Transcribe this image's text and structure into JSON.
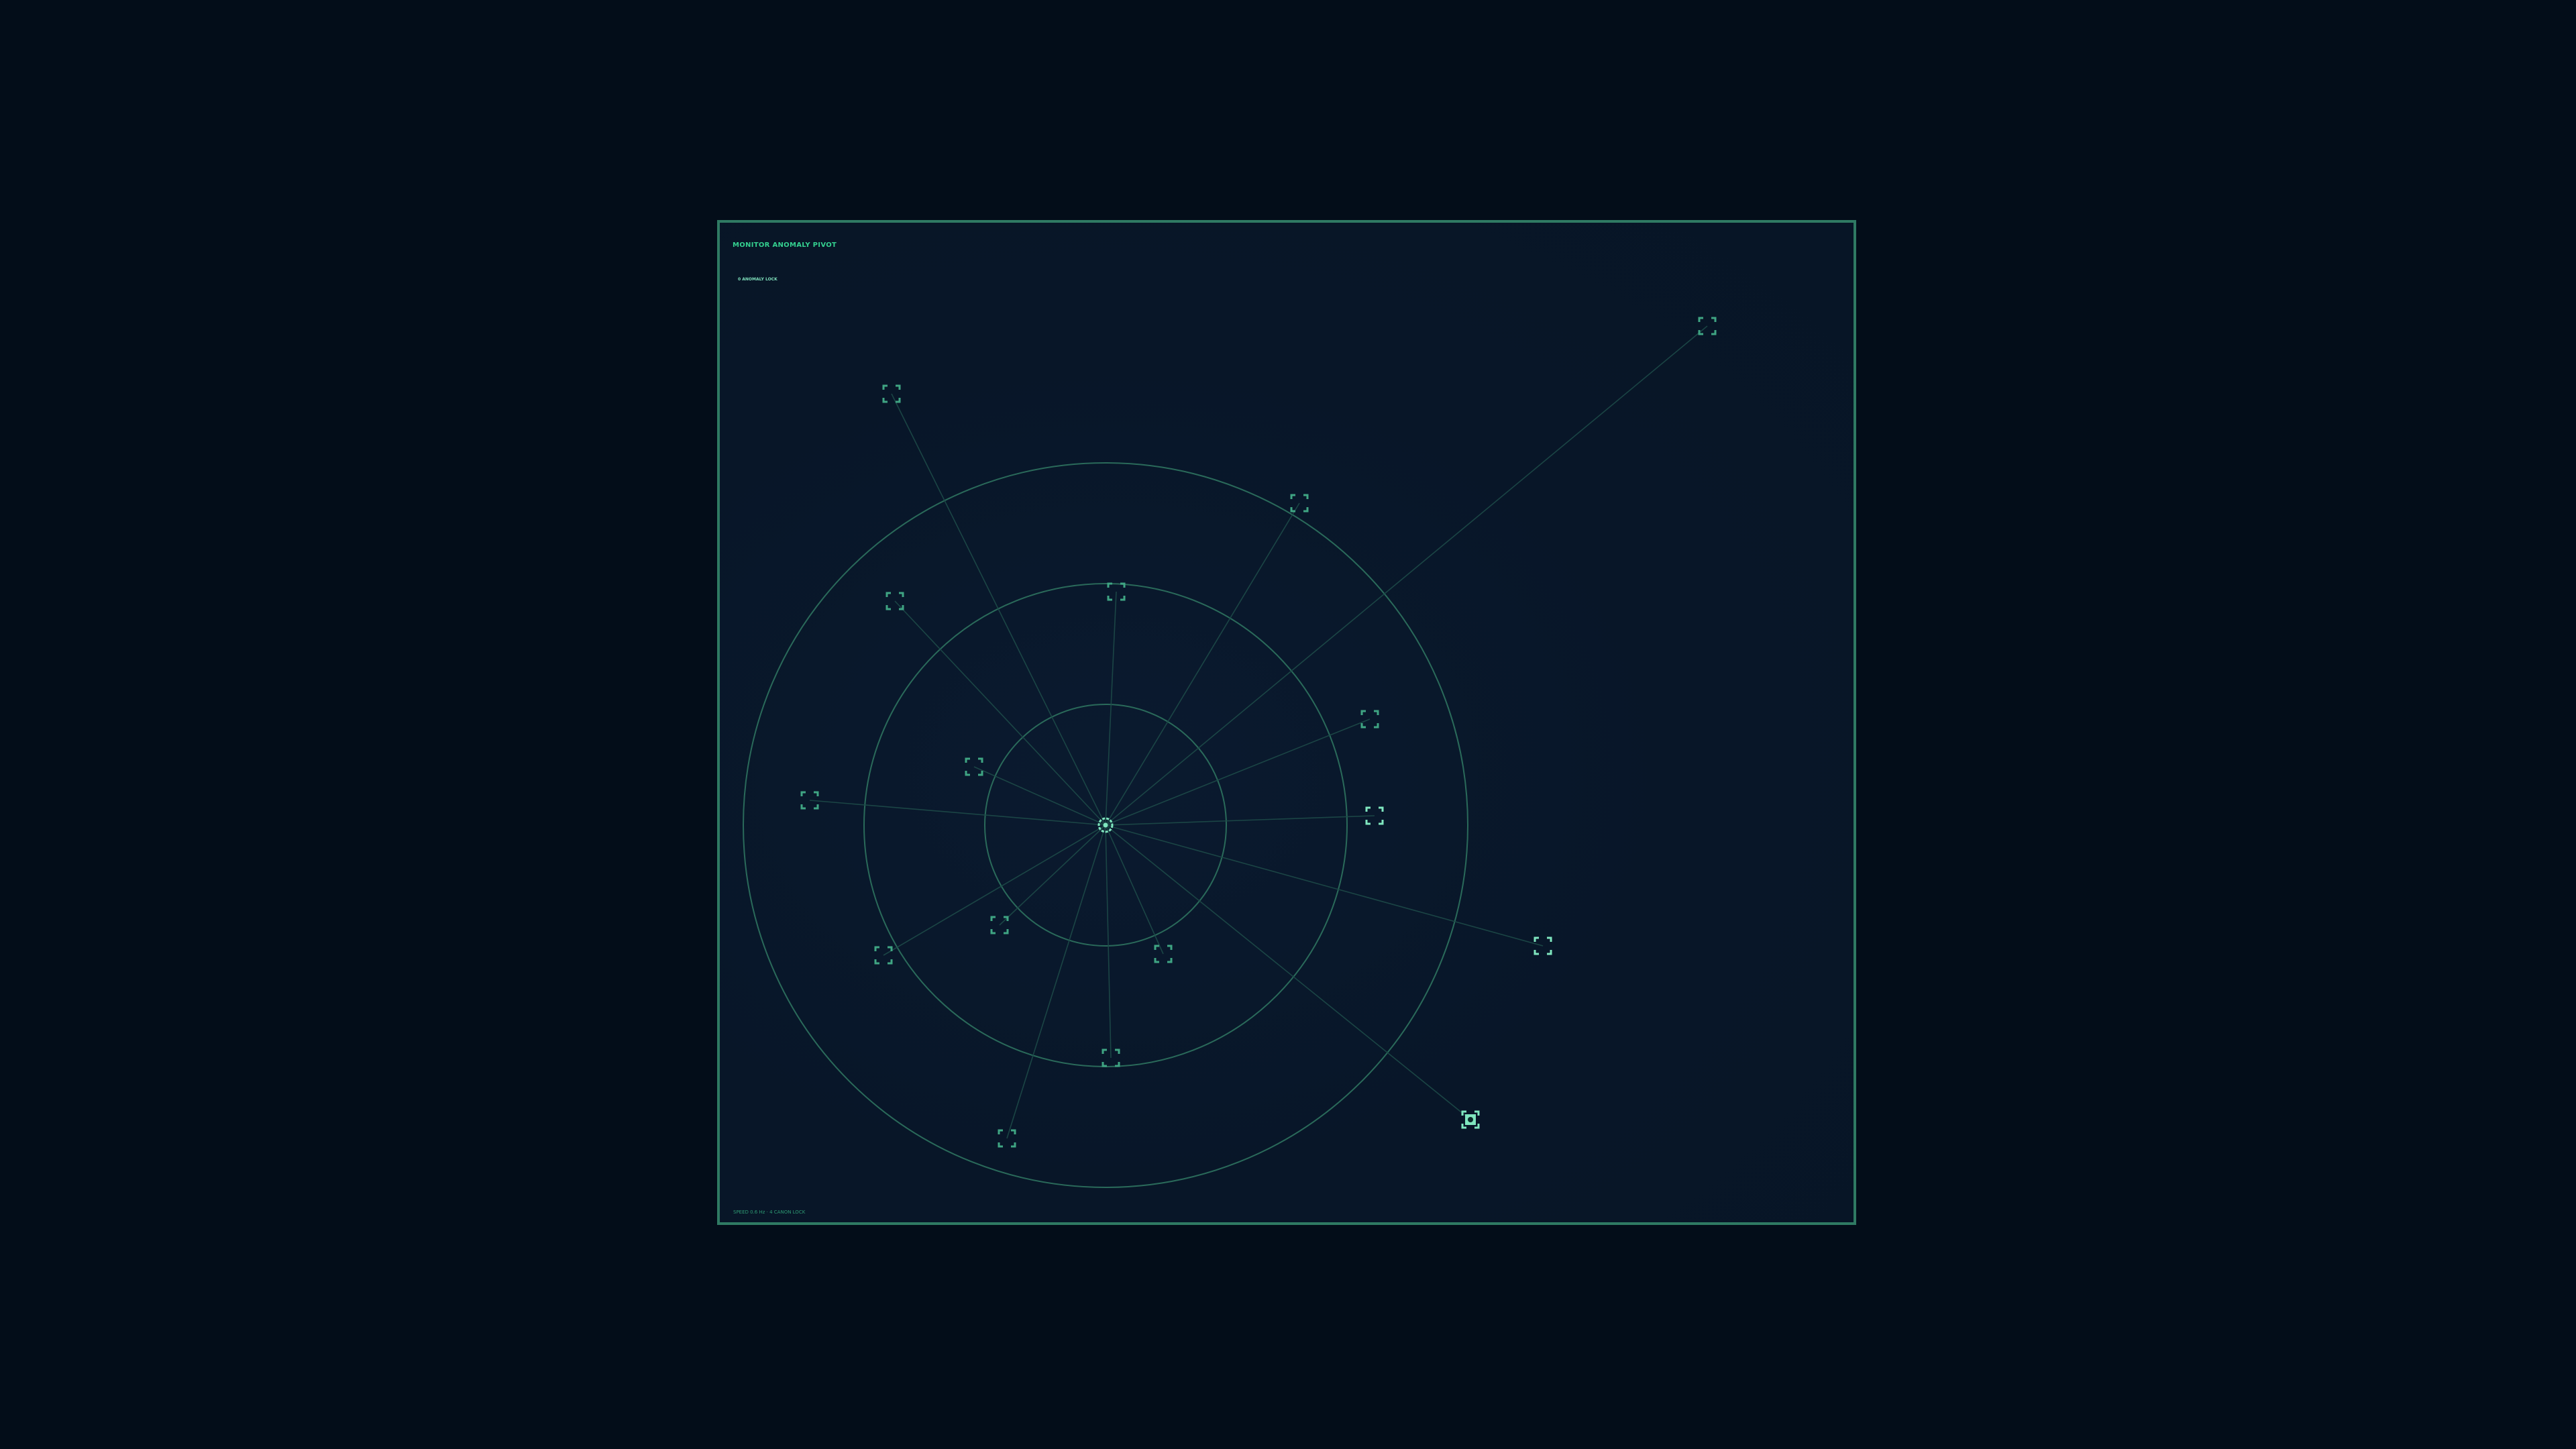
{
  "monitor": {
    "title": "MONITOR ANOMALY PIVOT",
    "subtitle": "0 ANOMALY LOCK",
    "footer": "SPEED 0.6 Hz · 4 CANON LOCK"
  },
  "colors": {
    "background": "#030d19",
    "panel": "#081628",
    "border": "#2f7a63",
    "accent": "#34d08f",
    "ring": "#2a6a5a",
    "spoke": "#1d4a48",
    "target": "#3fa583",
    "target_bright": "#7fe6bf"
  },
  "radar": {
    "center_icon": "pivot-reticle-icon",
    "ring_count": 3,
    "target_icon": "target-bracket-icon",
    "locked_target_icon": "locked-target-icon"
  }
}
